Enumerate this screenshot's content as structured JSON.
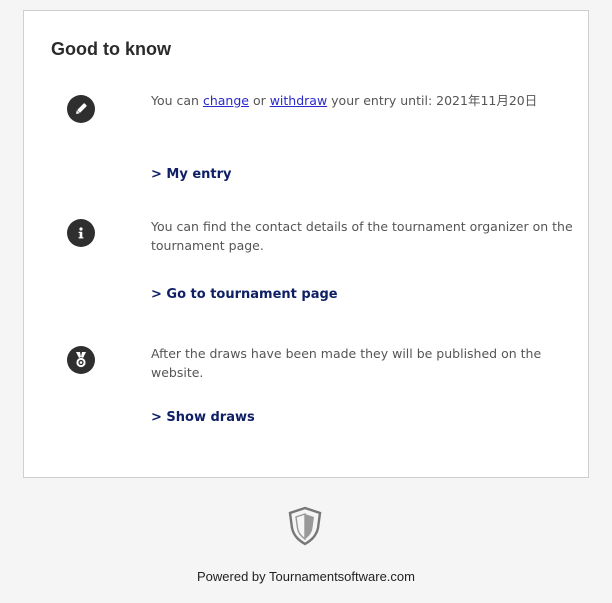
{
  "card": {
    "title": "Good to know"
  },
  "items": [
    {
      "icon": "pencil-icon",
      "text_prefix": "You can ",
      "change_link": "change",
      "text_or": " or ",
      "withdraw_link": "withdraw",
      "text_suffix": " your entry until: 2021年11月20日",
      "link": "> My entry"
    },
    {
      "icon": "info-icon",
      "text": "You can find the contact details of the tournament organizer on the tournament page.",
      "link": "> Go to tournament page"
    },
    {
      "icon": "medal-icon",
      "text": "After the draws have been made they will be published on the website.",
      "link": "> Show draws"
    }
  ],
  "footer": {
    "logo_icon": "shield-logo-icon",
    "text": "Powered by Tournamentsoftware.com"
  },
  "colors": {
    "link_inline": "#2a2acc",
    "link_action": "#0e1f66",
    "icon_bg": "#2f2f2f"
  }
}
